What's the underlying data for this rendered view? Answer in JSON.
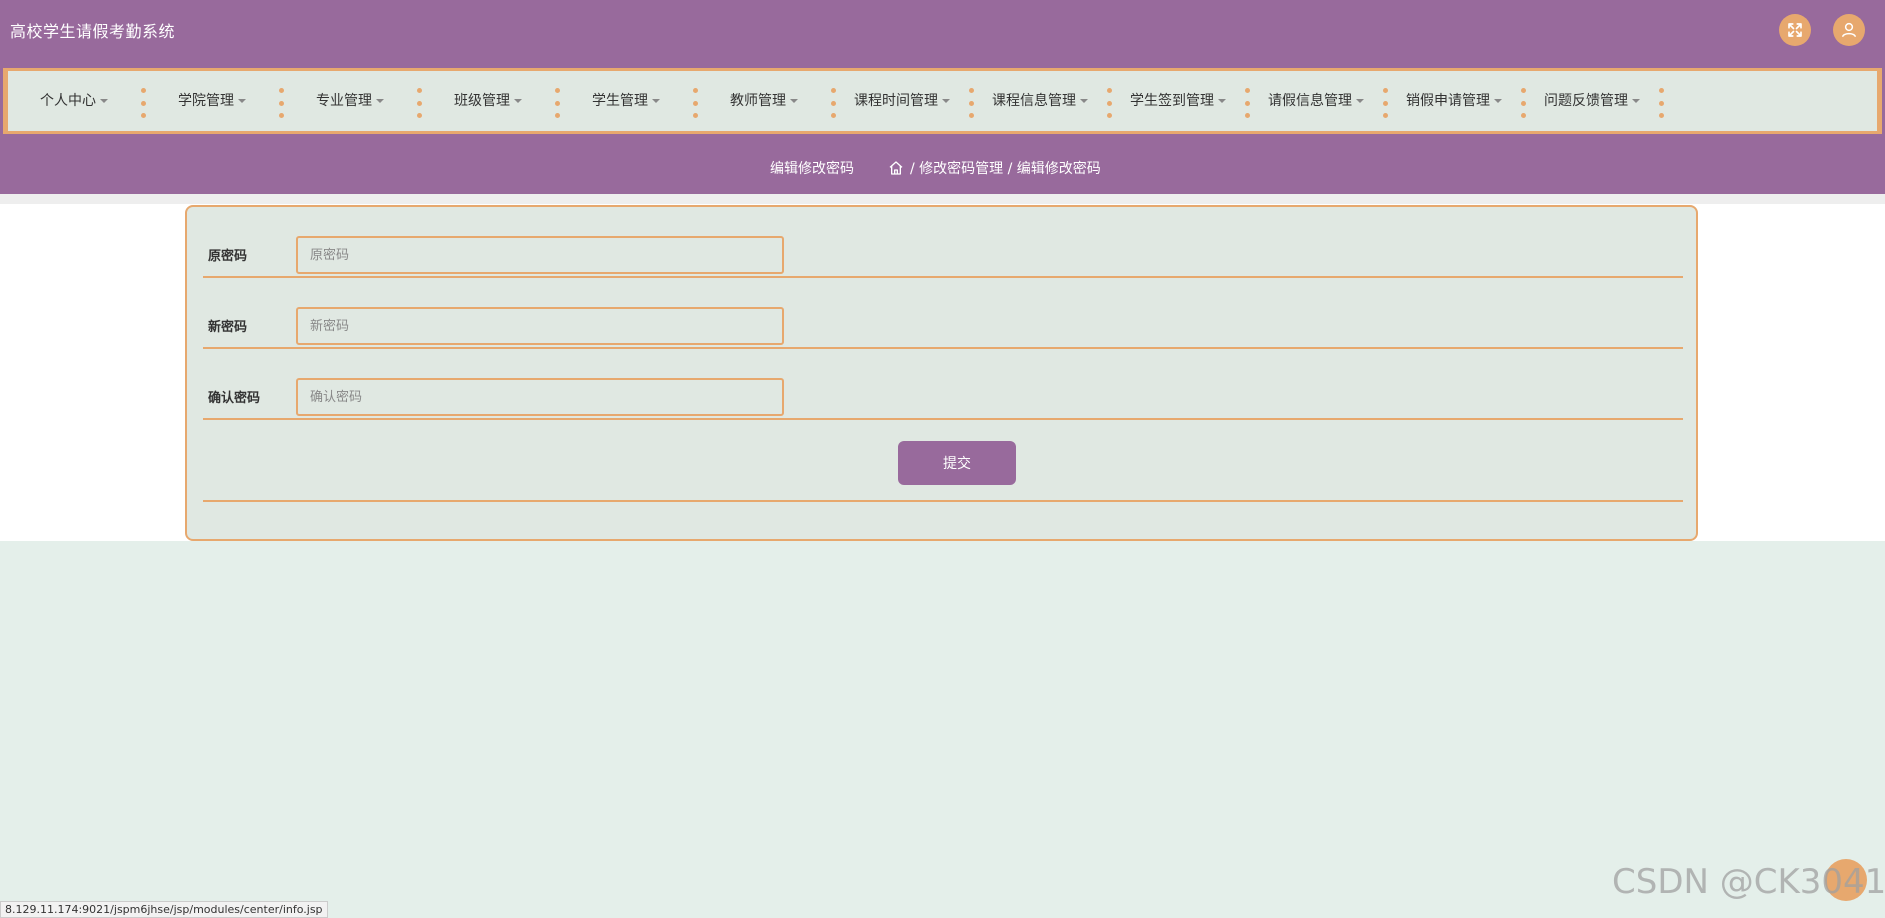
{
  "app": {
    "title": "高校学生请假考勤系统"
  },
  "header_buttons": {
    "fullscreen_icon": "expand-arrows",
    "user_icon": "user-profile"
  },
  "nav": {
    "items": [
      {
        "label": "个人中心"
      },
      {
        "label": "学院管理"
      },
      {
        "label": "专业管理"
      },
      {
        "label": "班级管理"
      },
      {
        "label": "学生管理"
      },
      {
        "label": "教师管理"
      },
      {
        "label": "课程时间管理"
      },
      {
        "label": "课程信息管理"
      },
      {
        "label": "学生签到管理"
      },
      {
        "label": "请假信息管理"
      },
      {
        "label": "销假申请管理"
      },
      {
        "label": "问题反馈管理"
      }
    ]
  },
  "breadcrumb": {
    "page_title": "编辑修改密码",
    "path": "/ 修改密码管理 / 编辑修改密码"
  },
  "form": {
    "fields": [
      {
        "label": "原密码",
        "placeholder": "原密码",
        "value": ""
      },
      {
        "label": "新密码",
        "placeholder": "新密码",
        "value": ""
      },
      {
        "label": "确认密码",
        "placeholder": "确认密码",
        "value": ""
      }
    ],
    "submit_label": "提交"
  },
  "status_bar": {
    "url": "8.129.11.174:9021/jspm6jhse/jsp/modules/center/info.jsp"
  },
  "watermark": "CSDN @CK3041",
  "colors": {
    "primary": "#986a9c",
    "accent": "#e7a86e",
    "panel": "#e0e8e2",
    "background": "#e4efea"
  }
}
